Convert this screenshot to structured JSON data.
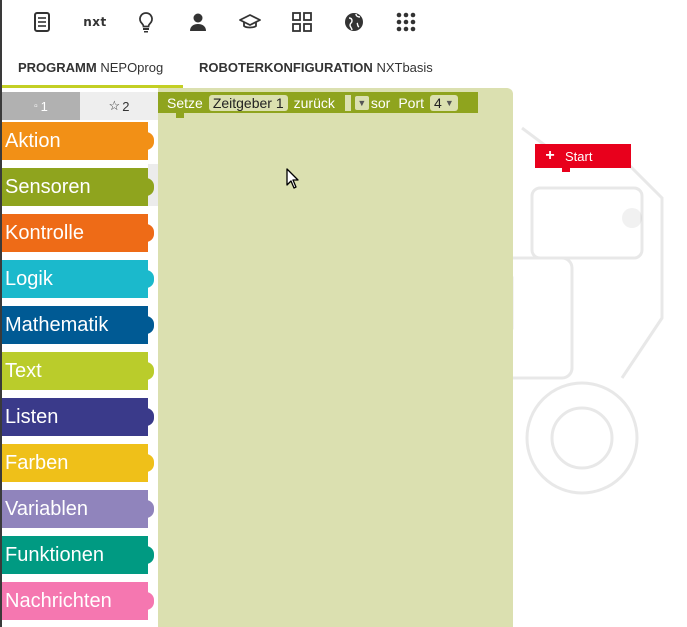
{
  "toolbar": {
    "icons": [
      "document-icon",
      "nxt-icon",
      "lightbulb-icon",
      "user-icon",
      "graduation-cap-icon",
      "grid-icon",
      "globe-icon",
      "apps-icon"
    ],
    "nxt_label": "nxt"
  },
  "tabs": [
    {
      "bold": "PROGRAMM",
      "name": "NEPOprog"
    },
    {
      "bold": "ROBOTERKONFIGURATION",
      "name": "NXTbasis"
    }
  ],
  "toolbox": {
    "level1": "1",
    "level2": "2",
    "categories": [
      {
        "label": "Aktion",
        "color": "#f29016"
      },
      {
        "label": "Sensoren",
        "color": "#8fa41e"
      },
      {
        "label": "Kontrolle",
        "color": "#ee6b17"
      },
      {
        "label": "Logik",
        "color": "#1bb9cc"
      },
      {
        "label": "Mathematik",
        "color": "#005a94"
      },
      {
        "label": "Text",
        "color": "#bacc2b"
      },
      {
        "label": "Listen",
        "color": "#3a3a8a"
      },
      {
        "label": "Farben",
        "color": "#efc019"
      },
      {
        "label": "Variablen",
        "color": "#9084bc"
      },
      {
        "label": "Funktionen",
        "color": "#009a82"
      },
      {
        "label": "Nachrichten",
        "color": "#f577b0"
      }
    ]
  },
  "flyout_block": {
    "setze": "Setze",
    "timer_field": "Zeitgeber 1",
    "zurueck": "zurück",
    "sensor_text": "sor",
    "port_label": "Port",
    "port_value": "4"
  },
  "start_block": {
    "label": "Start",
    "color": "#e8001c"
  }
}
